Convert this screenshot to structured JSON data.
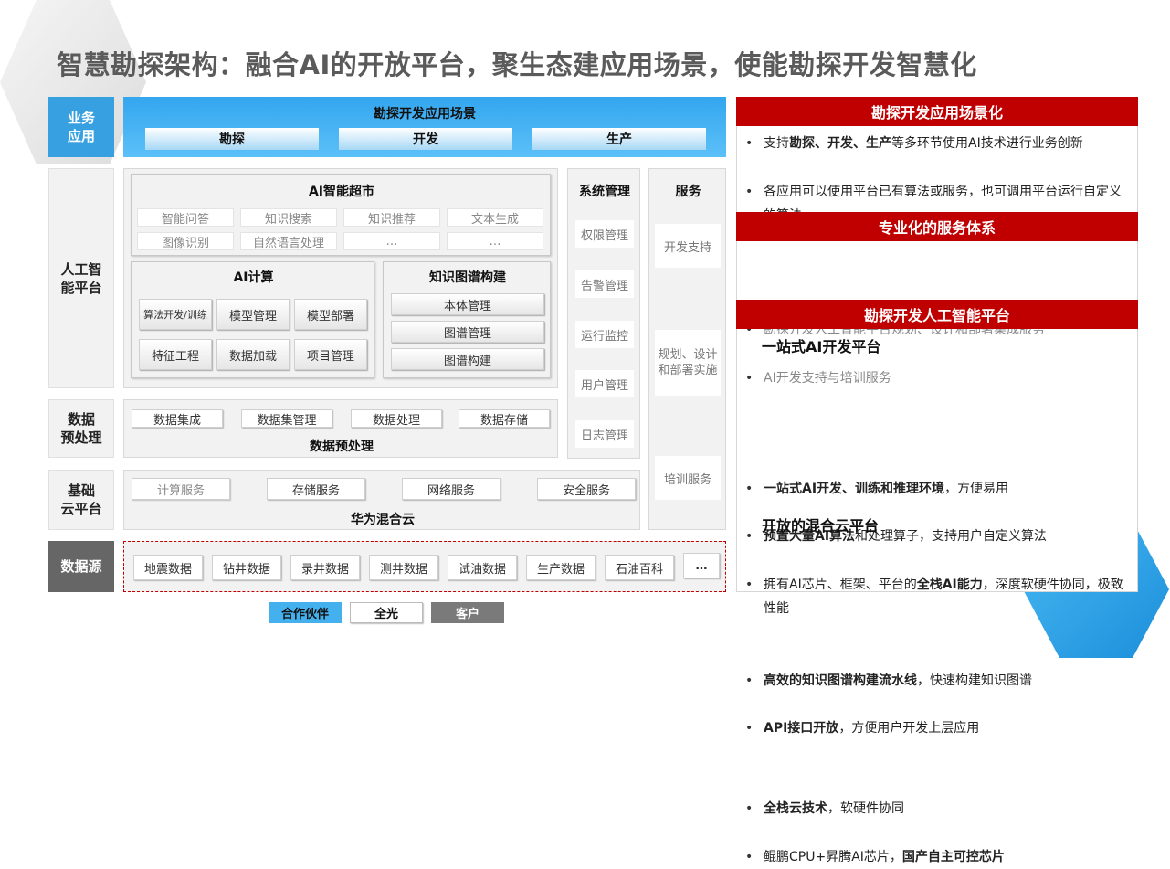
{
  "title": "智慧勘探架构：融合AI的开放平台，聚生态建应用场景，使能勘探开发智慧化",
  "colors": {
    "accent_red": "#c00000",
    "accent_blue": "#37a0e0",
    "grey_label": "#666666"
  },
  "layers": {
    "business": "业务\n应用",
    "ai": "人工智\n能平台",
    "data_pre": "数据\n预处理",
    "cloud": "基础\n云平台",
    "source": "数据源"
  },
  "business": {
    "title": "勘探开发应用场景",
    "items": [
      "勘探",
      "开发",
      "生产"
    ]
  },
  "ai_market": {
    "title": "AI智能超市",
    "items": [
      "智能问答",
      "知识搜索",
      "知识推荐",
      "文本生成",
      "图像识别",
      "自然语言处理",
      "…",
      "…"
    ]
  },
  "ai_compute": {
    "title": "AI计算",
    "items": [
      "算法开发/训练",
      "模型管理",
      "模型部署",
      "特征工程",
      "数据加载",
      "项目管理"
    ]
  },
  "kg": {
    "title": "知识图谱构建",
    "items": [
      "本体管理",
      "图谱管理",
      "图谱构建"
    ]
  },
  "system": {
    "title": "系统管理",
    "items": [
      "权限管理",
      "告警管理",
      "运行监控",
      "用户管理",
      "日志管理"
    ]
  },
  "service": {
    "title": "服务",
    "items": [
      "开发支持",
      "规划、设计\n和部署实施",
      "培训服务"
    ]
  },
  "data_pre": {
    "title": "数据预处理",
    "items": [
      "数据集成",
      "数据集管理",
      "数据处理",
      "数据存储"
    ]
  },
  "cloud": {
    "title": "华为混合云",
    "items": [
      "计算服务",
      "存储服务",
      "网络服务",
      "安全服务"
    ]
  },
  "source": {
    "items": [
      "地震数据",
      "钻井数据",
      "录井数据",
      "测井数据",
      "试油数据",
      "生产数据",
      "石油百科",
      "…"
    ]
  },
  "legend": [
    "合作伙伴",
    "全光",
    "客户"
  ],
  "right": {
    "h1": "勘探开发应用场景化",
    "b1_pre": "支持",
    "b1_bold": "勘探、开发、生产",
    "b1_post": "等多环节使用AI技术进行业务创新",
    "b2": "各应用可以使用平台已有算法或服务，也可调用平台运行自定义的算法",
    "h2": "专业化的服务体系",
    "b3": "勘探开发人工智能平台规划、设计和部署集成服务",
    "b4": "AI开发支持与培训服务",
    "h3": "勘探开发人工智能平台",
    "st1": "一站式AI开发平台",
    "c1_bold": "一站式AI开发、训练和推理环境",
    "c1_post": "，方便易用",
    "c2_bold": "预置大量AI算法",
    "c2_post": "和处理算子，支持用户自定义算法",
    "c3_pre": "拥有AI芯片、框架、平台的",
    "c3_bold": "全栈AI能力",
    "c3_post": "，深度软硬件协同，极致性能",
    "c4_bold": "高效的知识图谱构建流水线",
    "c4_post": "，快速构建知识图谱",
    "c5_bold": "API接口开放",
    "c5_post": "，方便用户开发上层应用",
    "st2": "开放的混合云平台",
    "d1_bold": "全栈云技术",
    "d1_post": "，软硬件协同",
    "d2_pre": "鲲鹏CPU+昇腾AI芯片，",
    "d2_bold": "国产自主可控芯片"
  }
}
